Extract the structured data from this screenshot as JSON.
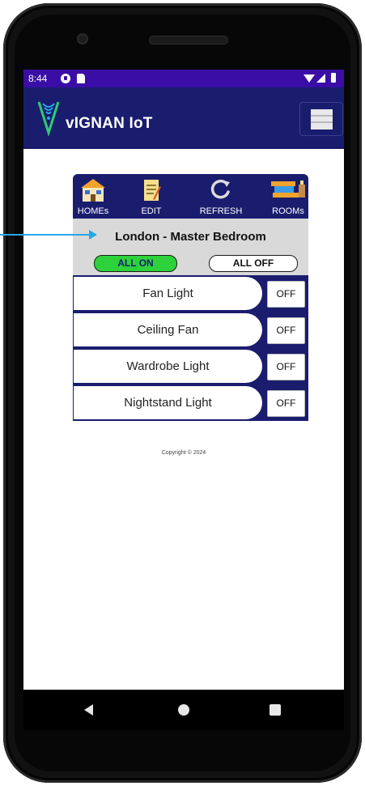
{
  "status_bar": {
    "time": "8:44"
  },
  "app_bar": {
    "title": "vIGNAN IoT"
  },
  "toolbar": {
    "homes_label": "HOMEs",
    "edit_label": "EDIT",
    "refresh_label": "REFRESH",
    "rooms_label": "ROOMs"
  },
  "room": {
    "title": "London - Master Bedroom",
    "all_on_label": "ALL ON",
    "all_off_label": "ALL OFF"
  },
  "devices": [
    {
      "name": "Fan Light",
      "state": "OFF"
    },
    {
      "name": "Ceiling Fan",
      "state": "OFF"
    },
    {
      "name": "Wardrobe Light",
      "state": "OFF"
    },
    {
      "name": "Nightstand Light",
      "state": "OFF"
    }
  ],
  "footer": {
    "copyright": "Copyright © 2024"
  },
  "colors": {
    "status_bar": "#3a0ea6",
    "primary": "#1a1d6e",
    "all_on": "#2dd23b",
    "annotation_arrow": "#27a7e6"
  },
  "icons": [
    "houses-icon",
    "edit-icon",
    "refresh-icon",
    "rooms-icon",
    "menu-icon",
    "logo-icon"
  ]
}
